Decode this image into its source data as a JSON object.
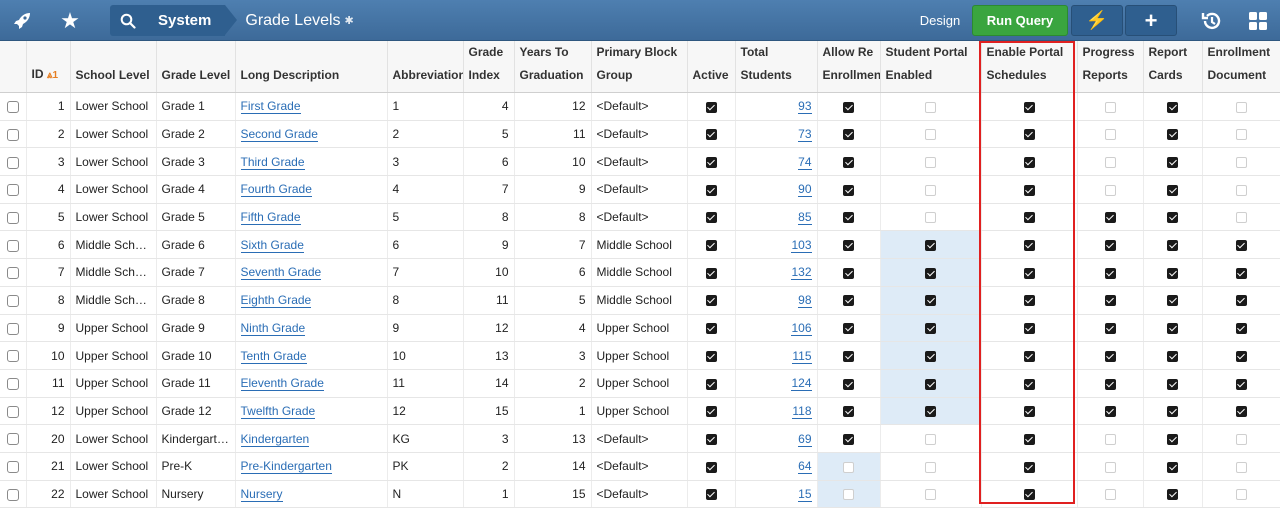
{
  "topbar": {
    "rocket_icon": "rocket-icon",
    "star_icon": "star-icon",
    "breadcrumb_root": "System",
    "page_title": "Grade Levels",
    "modified_marker": "✱",
    "design_label": "Design",
    "run_query_label": "Run Query",
    "bolt_label": "⚡",
    "plus_label": "+",
    "accent_green": "#3aa53f",
    "bar_blue": "#3d6a99"
  },
  "columns": {
    "id": "ID",
    "sort_indicator": "⩓1",
    "school_level": "School Level",
    "grade_level": "Grade Level",
    "long_description": "Long Description",
    "abbreviation": "Abbreviation",
    "grade_index_1": "Grade",
    "grade_index_2": "Index",
    "years_1": "Years To",
    "years_2": "Graduation",
    "block_1": "Primary Block",
    "block_2": "Group",
    "active": "Active",
    "total_1": "Total",
    "total_2": "Students",
    "allow_1": "Allow Re",
    "allow_2": "Enrollment",
    "portal_1": "Student Portal",
    "portal_2": "Enabled",
    "sched_1": "Enable Portal",
    "sched_2": "Schedules",
    "progress_1": "Progress",
    "progress_2": "Reports",
    "report_1": "Report",
    "report_2": "Cards",
    "enroll_1": "Enrollment",
    "enroll_2": "Document"
  },
  "rows": [
    {
      "id": "1",
      "school": "Lower School",
      "grade": "Grade 1",
      "desc": "First Grade",
      "abbr": "1",
      "index": "4",
      "years": "12",
      "block": "<Default>",
      "active": true,
      "total": "93",
      "allow": true,
      "portal": false,
      "sched": true,
      "progress": false,
      "cards": true,
      "enroll": false
    },
    {
      "id": "2",
      "school": "Lower School",
      "grade": "Grade 2",
      "desc": "Second Grade",
      "abbr": "2",
      "index": "5",
      "years": "11",
      "block": "<Default>",
      "active": true,
      "total": "73",
      "allow": true,
      "portal": false,
      "sched": true,
      "progress": false,
      "cards": true,
      "enroll": false
    },
    {
      "id": "3",
      "school": "Lower School",
      "grade": "Grade 3",
      "desc": "Third Grade",
      "abbr": "3",
      "index": "6",
      "years": "10",
      "block": "<Default>",
      "active": true,
      "total": "74",
      "allow": true,
      "portal": false,
      "sched": true,
      "progress": false,
      "cards": true,
      "enroll": false
    },
    {
      "id": "4",
      "school": "Lower School",
      "grade": "Grade 4",
      "desc": "Fourth Grade",
      "abbr": "4",
      "index": "7",
      "years": "9",
      "block": "<Default>",
      "active": true,
      "total": "90",
      "allow": true,
      "portal": false,
      "sched": true,
      "progress": false,
      "cards": true,
      "enroll": false
    },
    {
      "id": "5",
      "school": "Lower School",
      "grade": "Grade 5",
      "desc": "Fifth Grade",
      "abbr": "5",
      "index": "8",
      "years": "8",
      "block": "<Default>",
      "active": true,
      "total": "85",
      "allow": true,
      "portal": false,
      "sched": true,
      "progress": true,
      "cards": true,
      "enroll": false
    },
    {
      "id": "6",
      "school": "Middle School",
      "grade": "Grade 6",
      "desc": "Sixth Grade",
      "abbr": "6",
      "index": "9",
      "years": "7",
      "block": "Middle School",
      "active": true,
      "total": "103",
      "allow": true,
      "portal": true,
      "sched": true,
      "progress": true,
      "cards": true,
      "enroll": true
    },
    {
      "id": "7",
      "school": "Middle School",
      "grade": "Grade 7",
      "desc": "Seventh Grade",
      "abbr": "7",
      "index": "10",
      "years": "6",
      "block": "Middle School",
      "active": true,
      "total": "132",
      "allow": true,
      "portal": true,
      "sched": true,
      "progress": true,
      "cards": true,
      "enroll": true
    },
    {
      "id": "8",
      "school": "Middle School",
      "grade": "Grade 8",
      "desc": "Eighth Grade",
      "abbr": "8",
      "index": "11",
      "years": "5",
      "block": "Middle School",
      "active": true,
      "total": "98",
      "allow": true,
      "portal": true,
      "sched": true,
      "progress": true,
      "cards": true,
      "enroll": true
    },
    {
      "id": "9",
      "school": "Upper School",
      "grade": "Grade 9",
      "desc": "Ninth Grade",
      "abbr": "9",
      "index": "12",
      "years": "4",
      "block": "Upper School",
      "active": true,
      "total": "106",
      "allow": true,
      "portal": true,
      "sched": true,
      "progress": true,
      "cards": true,
      "enroll": true
    },
    {
      "id": "10",
      "school": "Upper School",
      "grade": "Grade 10",
      "desc": "Tenth Grade",
      "abbr": "10",
      "index": "13",
      "years": "3",
      "block": "Upper School",
      "active": true,
      "total": "115",
      "allow": true,
      "portal": true,
      "sched": true,
      "progress": true,
      "cards": true,
      "enroll": true
    },
    {
      "id": "11",
      "school": "Upper School",
      "grade": "Grade 11",
      "desc": "Eleventh Grade",
      "abbr": "11",
      "index": "14",
      "years": "2",
      "block": "Upper School",
      "active": true,
      "total": "124",
      "allow": true,
      "portal": true,
      "sched": true,
      "progress": true,
      "cards": true,
      "enroll": true
    },
    {
      "id": "12",
      "school": "Upper School",
      "grade": "Grade 12",
      "desc": "Twelfth Grade",
      "abbr": "12",
      "index": "15",
      "years": "1",
      "block": "Upper School",
      "active": true,
      "total": "118",
      "allow": true,
      "portal": true,
      "sched": true,
      "progress": true,
      "cards": true,
      "enroll": true
    },
    {
      "id": "20",
      "school": "Lower School",
      "grade": "Kindergarte...",
      "desc": "Kindergarten",
      "abbr": "KG",
      "index": "3",
      "years": "13",
      "block": "<Default>",
      "active": true,
      "total": "69",
      "allow": true,
      "portal": false,
      "sched": true,
      "progress": false,
      "cards": true,
      "enroll": false
    },
    {
      "id": "21",
      "school": "Lower School",
      "grade": "Pre-K",
      "desc": "Pre-Kindergarten",
      "abbr": "PK",
      "index": "2",
      "years": "14",
      "block": "<Default>",
      "active": true,
      "total": "64",
      "allow": false,
      "portal": false,
      "sched": true,
      "progress": false,
      "cards": true,
      "enroll": false
    },
    {
      "id": "22",
      "school": "Lower School",
      "grade": "Nursery",
      "desc": "Nursery",
      "abbr": "N",
      "index": "1",
      "years": "15",
      "block": "<Default>",
      "active": true,
      "total": "15",
      "allow": false,
      "portal": false,
      "sched": true,
      "progress": false,
      "cards": true,
      "enroll": false
    }
  ],
  "highlight_color": "#deebf7",
  "callout_color": "#e02020"
}
